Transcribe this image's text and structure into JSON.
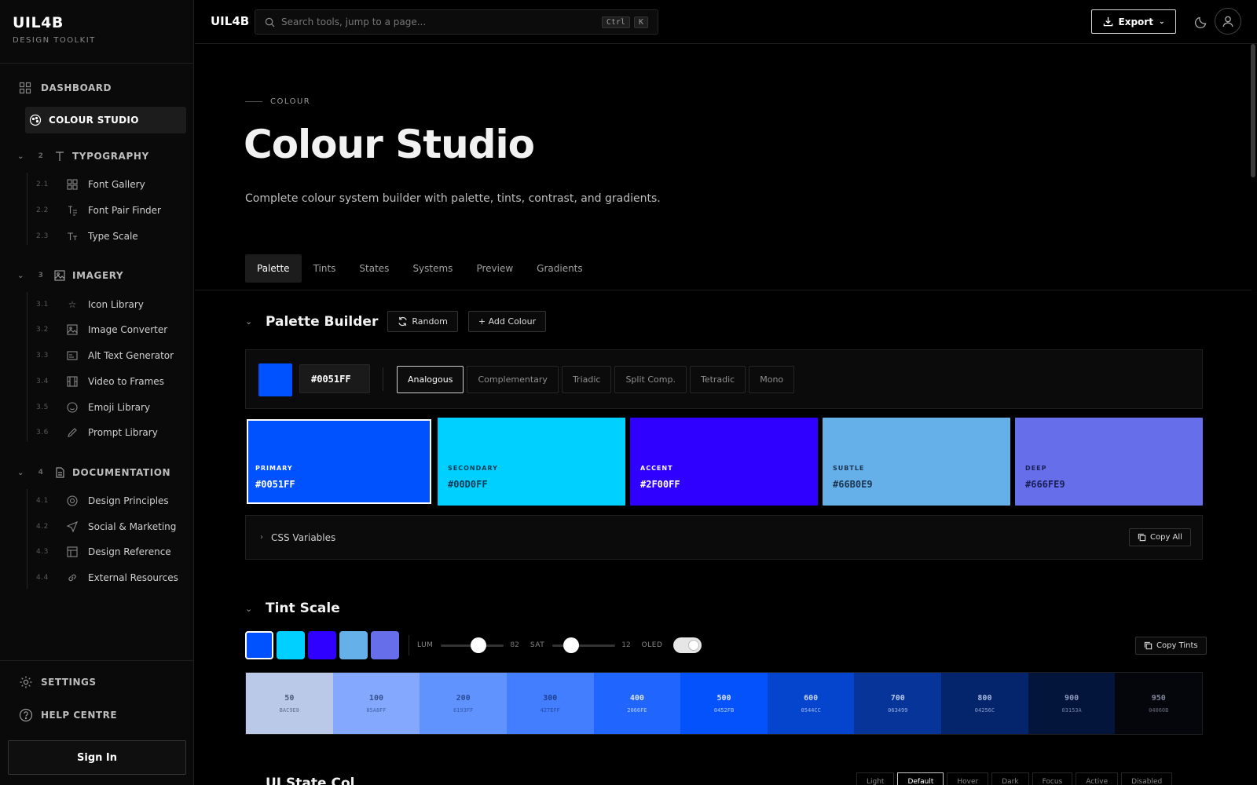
{
  "brand": {
    "title": "UIL4B",
    "subtitle": "DESIGN TOOLKIT"
  },
  "sidebar": {
    "dashboard": "DASHBOARD",
    "active": "COLOUR STUDIO",
    "sections": [
      {
        "num": "2",
        "label": "TYPOGRAPHY",
        "items": [
          {
            "n": "2.1",
            "label": "Font Gallery",
            "icon": "grid-icon"
          },
          {
            "n": "2.2",
            "label": "Font Pair Finder",
            "icon": "text-pair-icon"
          },
          {
            "n": "2.3",
            "label": "Type Scale",
            "icon": "type-scale-icon"
          }
        ]
      },
      {
        "num": "3",
        "label": "IMAGERY",
        "items": [
          {
            "n": "3.1",
            "label": "Icon Library",
            "icon": "star-icon"
          },
          {
            "n": "3.2",
            "label": "Image Converter",
            "icon": "image-icon"
          },
          {
            "n": "3.3",
            "label": "Alt Text Generator",
            "icon": "alt-text-icon"
          },
          {
            "n": "3.4",
            "label": "Video to Frames",
            "icon": "film-icon"
          },
          {
            "n": "3.5",
            "label": "Emoji Library",
            "icon": "smile-icon"
          },
          {
            "n": "3.6",
            "label": "Prompt Library",
            "icon": "edit-icon"
          }
        ]
      },
      {
        "num": "4",
        "label": "DOCUMENTATION",
        "items": [
          {
            "n": "4.1",
            "label": "Design Principles",
            "icon": "target-icon"
          },
          {
            "n": "4.2",
            "label": "Social & Marketing",
            "icon": "send-icon"
          },
          {
            "n": "4.3",
            "label": "Design Reference",
            "icon": "layout-icon"
          },
          {
            "n": "4.4",
            "label": "External Resources",
            "icon": "link-icon"
          }
        ]
      }
    ],
    "settings": "SETTINGS",
    "help": "HELP CENTRE",
    "signin": "Sign In"
  },
  "topbar": {
    "logo": "UIL4B",
    "search_placeholder": "Search tools, jump to a page...",
    "kbd1": "Ctrl",
    "kbd2": "K",
    "export": "Export"
  },
  "page": {
    "eyebrow": "COLOUR",
    "title": "Colour Studio",
    "lead": "Complete colour system builder with palette, tints, contrast, and gradients."
  },
  "tabs": [
    "Palette",
    "Tints",
    "States",
    "Systems",
    "Preview",
    "Gradients"
  ],
  "palette_builder": {
    "title": "Palette Builder",
    "random": "Random",
    "add": "+ Add Colour",
    "base_hex": "#0051FF",
    "harmonies": [
      "Analogous",
      "Complementary",
      "Triadic",
      "Split Comp.",
      "Tetradic",
      "Mono"
    ],
    "colours": [
      {
        "role": "PRIMARY",
        "hex": "#0051FF",
        "bg": "#0051FF",
        "fg": "#ffffff"
      },
      {
        "role": "SECONDARY",
        "hex": "#00D0FF",
        "bg": "#00D0FF",
        "fg": "#0a3a55"
      },
      {
        "role": "ACCENT",
        "hex": "#2F00FF",
        "bg": "#2F00FF",
        "fg": "#ffffff"
      },
      {
        "role": "SUBTLE",
        "hex": "#66B0E9",
        "bg": "#66B0E9",
        "fg": "#1b3550"
      },
      {
        "role": "DEEP",
        "hex": "#666FE9",
        "bg": "#666FE9",
        "fg": "#1a1f55"
      }
    ],
    "css_variables": "CSS Variables",
    "copy_all": "Copy All"
  },
  "tint_scale": {
    "title": "Tint Scale",
    "lum_label": "LUM",
    "lum_value": "82",
    "sat_label": "SAT",
    "sat_value": "12",
    "oled_label": "OLED",
    "copy": "Copy Tints",
    "tints": [
      {
        "level": "50",
        "hex": "BAC9E8",
        "bg": "#BAC9E8",
        "fg": "#4a5a78"
      },
      {
        "level": "100",
        "hex": "85A8FF",
        "bg": "#85A8FF",
        "fg": "#34528f"
      },
      {
        "level": "200",
        "hex": "6193FF",
        "bg": "#6193FF",
        "fg": "#2a4b9a"
      },
      {
        "level": "300",
        "hex": "427EFF",
        "bg": "#427EFF",
        "fg": "#1f3f8f"
      },
      {
        "level": "400",
        "hex": "2066FE",
        "bg": "#2066FE",
        "fg": "#d8e3ff"
      },
      {
        "level": "500",
        "hex": "0452FB",
        "bg": "#0452FB",
        "fg": "#d8e3ff"
      },
      {
        "level": "600",
        "hex": "0544CC",
        "bg": "#0544CC",
        "fg": "#c5d4f5"
      },
      {
        "level": "700",
        "hex": "063499",
        "bg": "#063499",
        "fg": "#b9c9ee"
      },
      {
        "level": "800",
        "hex": "04256C",
        "bg": "#04256C",
        "fg": "#aab9df"
      },
      {
        "level": "900",
        "hex": "03153A",
        "bg": "#03153A",
        "fg": "#8e9bbd"
      },
      {
        "level": "950",
        "hex": "04060B",
        "bg": "#04060B",
        "fg": "#7f8598"
      }
    ]
  },
  "ui_state": {
    "title": "UI State Col",
    "tabs": [
      "Light",
      "Default",
      "Hover",
      "Dark",
      "Focus",
      "Active",
      "Disabled"
    ]
  }
}
